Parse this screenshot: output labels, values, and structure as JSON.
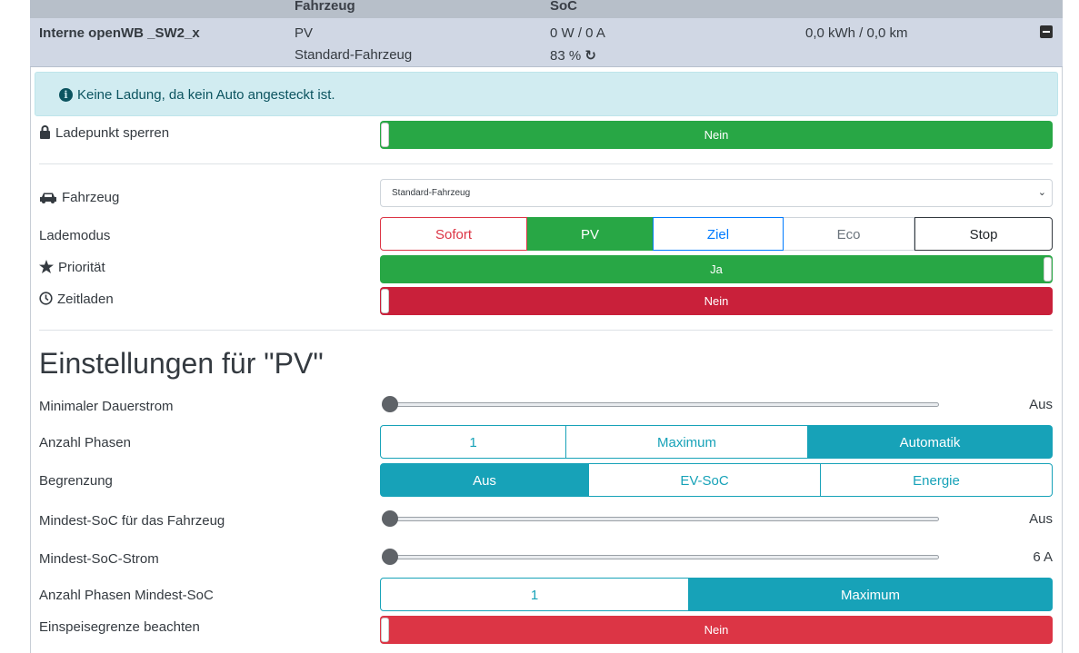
{
  "table_header": {
    "col_vehicle": "Fahrzeug",
    "col_soc": "SoC"
  },
  "chargepoint": {
    "name": "Interne openWB _SW2_x",
    "mode_short": "PV",
    "vehicle": "Standard-Fahrzeug",
    "power": "0 W / 0 A",
    "soc": "83 %",
    "energy": "0,0 kWh / 0,0 km"
  },
  "alert": {
    "text": "Keine Ladung, da kein Auto angesteckt ist."
  },
  "lock": {
    "label": "Ladepunkt sperren",
    "value": "Nein"
  },
  "vehicle_select": {
    "label": "Fahrzeug",
    "value": "Standard-Fahrzeug"
  },
  "charge_mode": {
    "label": "Lademodus",
    "options": [
      "Sofort",
      "PV",
      "Ziel",
      "Eco",
      "Stop"
    ],
    "selected": "PV",
    "colors": {
      "Sofort": "#dc3545",
      "PV": "#28a745",
      "Ziel": "#007bff",
      "Eco": "#6c757d",
      "Stop": "#343a40"
    }
  },
  "priority": {
    "label": "Priorität",
    "value": "Ja"
  },
  "timed": {
    "label": "Zeitladen",
    "value": "Nein"
  },
  "settings_heading": "Einstellungen für \"PV\"",
  "min_current": {
    "label": "Minimaler Dauerstrom",
    "value": "Aus",
    "level": 0
  },
  "phases": {
    "label": "Anzahl Phasen",
    "options": [
      "1",
      "Maximum",
      "Automatik"
    ],
    "selected": "Automatik"
  },
  "limit": {
    "label": "Begrenzung",
    "options": [
      "Aus",
      "EV-SoC",
      "Energie"
    ],
    "selected": "Aus"
  },
  "min_soc": {
    "label": "Mindest-SoC für das Fahrzeug",
    "value": "Aus",
    "level": 0
  },
  "min_soc_current": {
    "label": "Mindest-SoC-Strom",
    "value": "6 A",
    "level": 0
  },
  "min_soc_phases": {
    "label": "Anzahl Phasen Mindest-SoC",
    "options": [
      "1",
      "Maximum"
    ],
    "selected": "Maximum"
  },
  "feed_in": {
    "label": "Einspeisegrenze beachten",
    "value": "Nein"
  },
  "accent": "#17a2b8"
}
